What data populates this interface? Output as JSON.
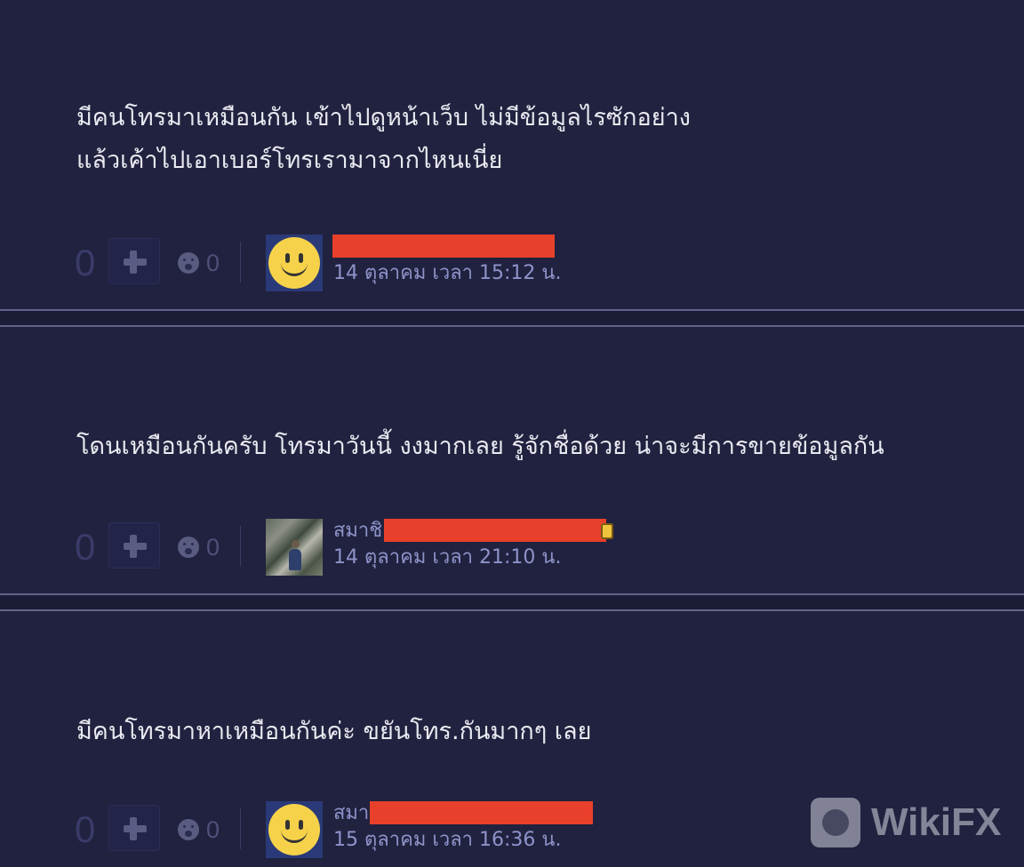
{
  "comments": [
    {
      "text": "มีคนโทรมาเหมือนกัน เข้าไปดูหน้าเว็บ ไม่มีข้อมูลไรซักอย่าง\nแล้วเค้าไปเอาเบอร์โทรเรามาจากไหนเนี่ย",
      "vote_count": "0",
      "emotion_count": "0",
      "avatar": "smiley-icon",
      "author_visible": "",
      "timestamp": "14 ตุลาคม เวลา 15:12 น."
    },
    {
      "text": "โดนเหมือนกันครับ  โทรมาวันนี้ งงมากเลย รู้จักชื่อด้วย น่าจะมีการขายข้อมูลกัน",
      "vote_count": "0",
      "emotion_count": "0",
      "avatar": "photo",
      "author_visible": "สมาชิ",
      "timestamp": "14 ตุลาคม เวลา 21:10 น."
    },
    {
      "text": "มีคนโทรมาหาเหมือนกันค่ะ ขยันโทร.กันมากๆ เลย",
      "vote_count": "0",
      "emotion_count": "0",
      "avatar": "smiley-icon",
      "author_visible": "สมา",
      "timestamp": "15 ตุลาคม เวลา 16:36 น."
    }
  ],
  "watermark": {
    "text": "WikiFX"
  },
  "colors": {
    "background": "#21223f",
    "text": "#e9e9f1",
    "meta_text": "#8e93c9",
    "redaction": "#e8402a"
  }
}
